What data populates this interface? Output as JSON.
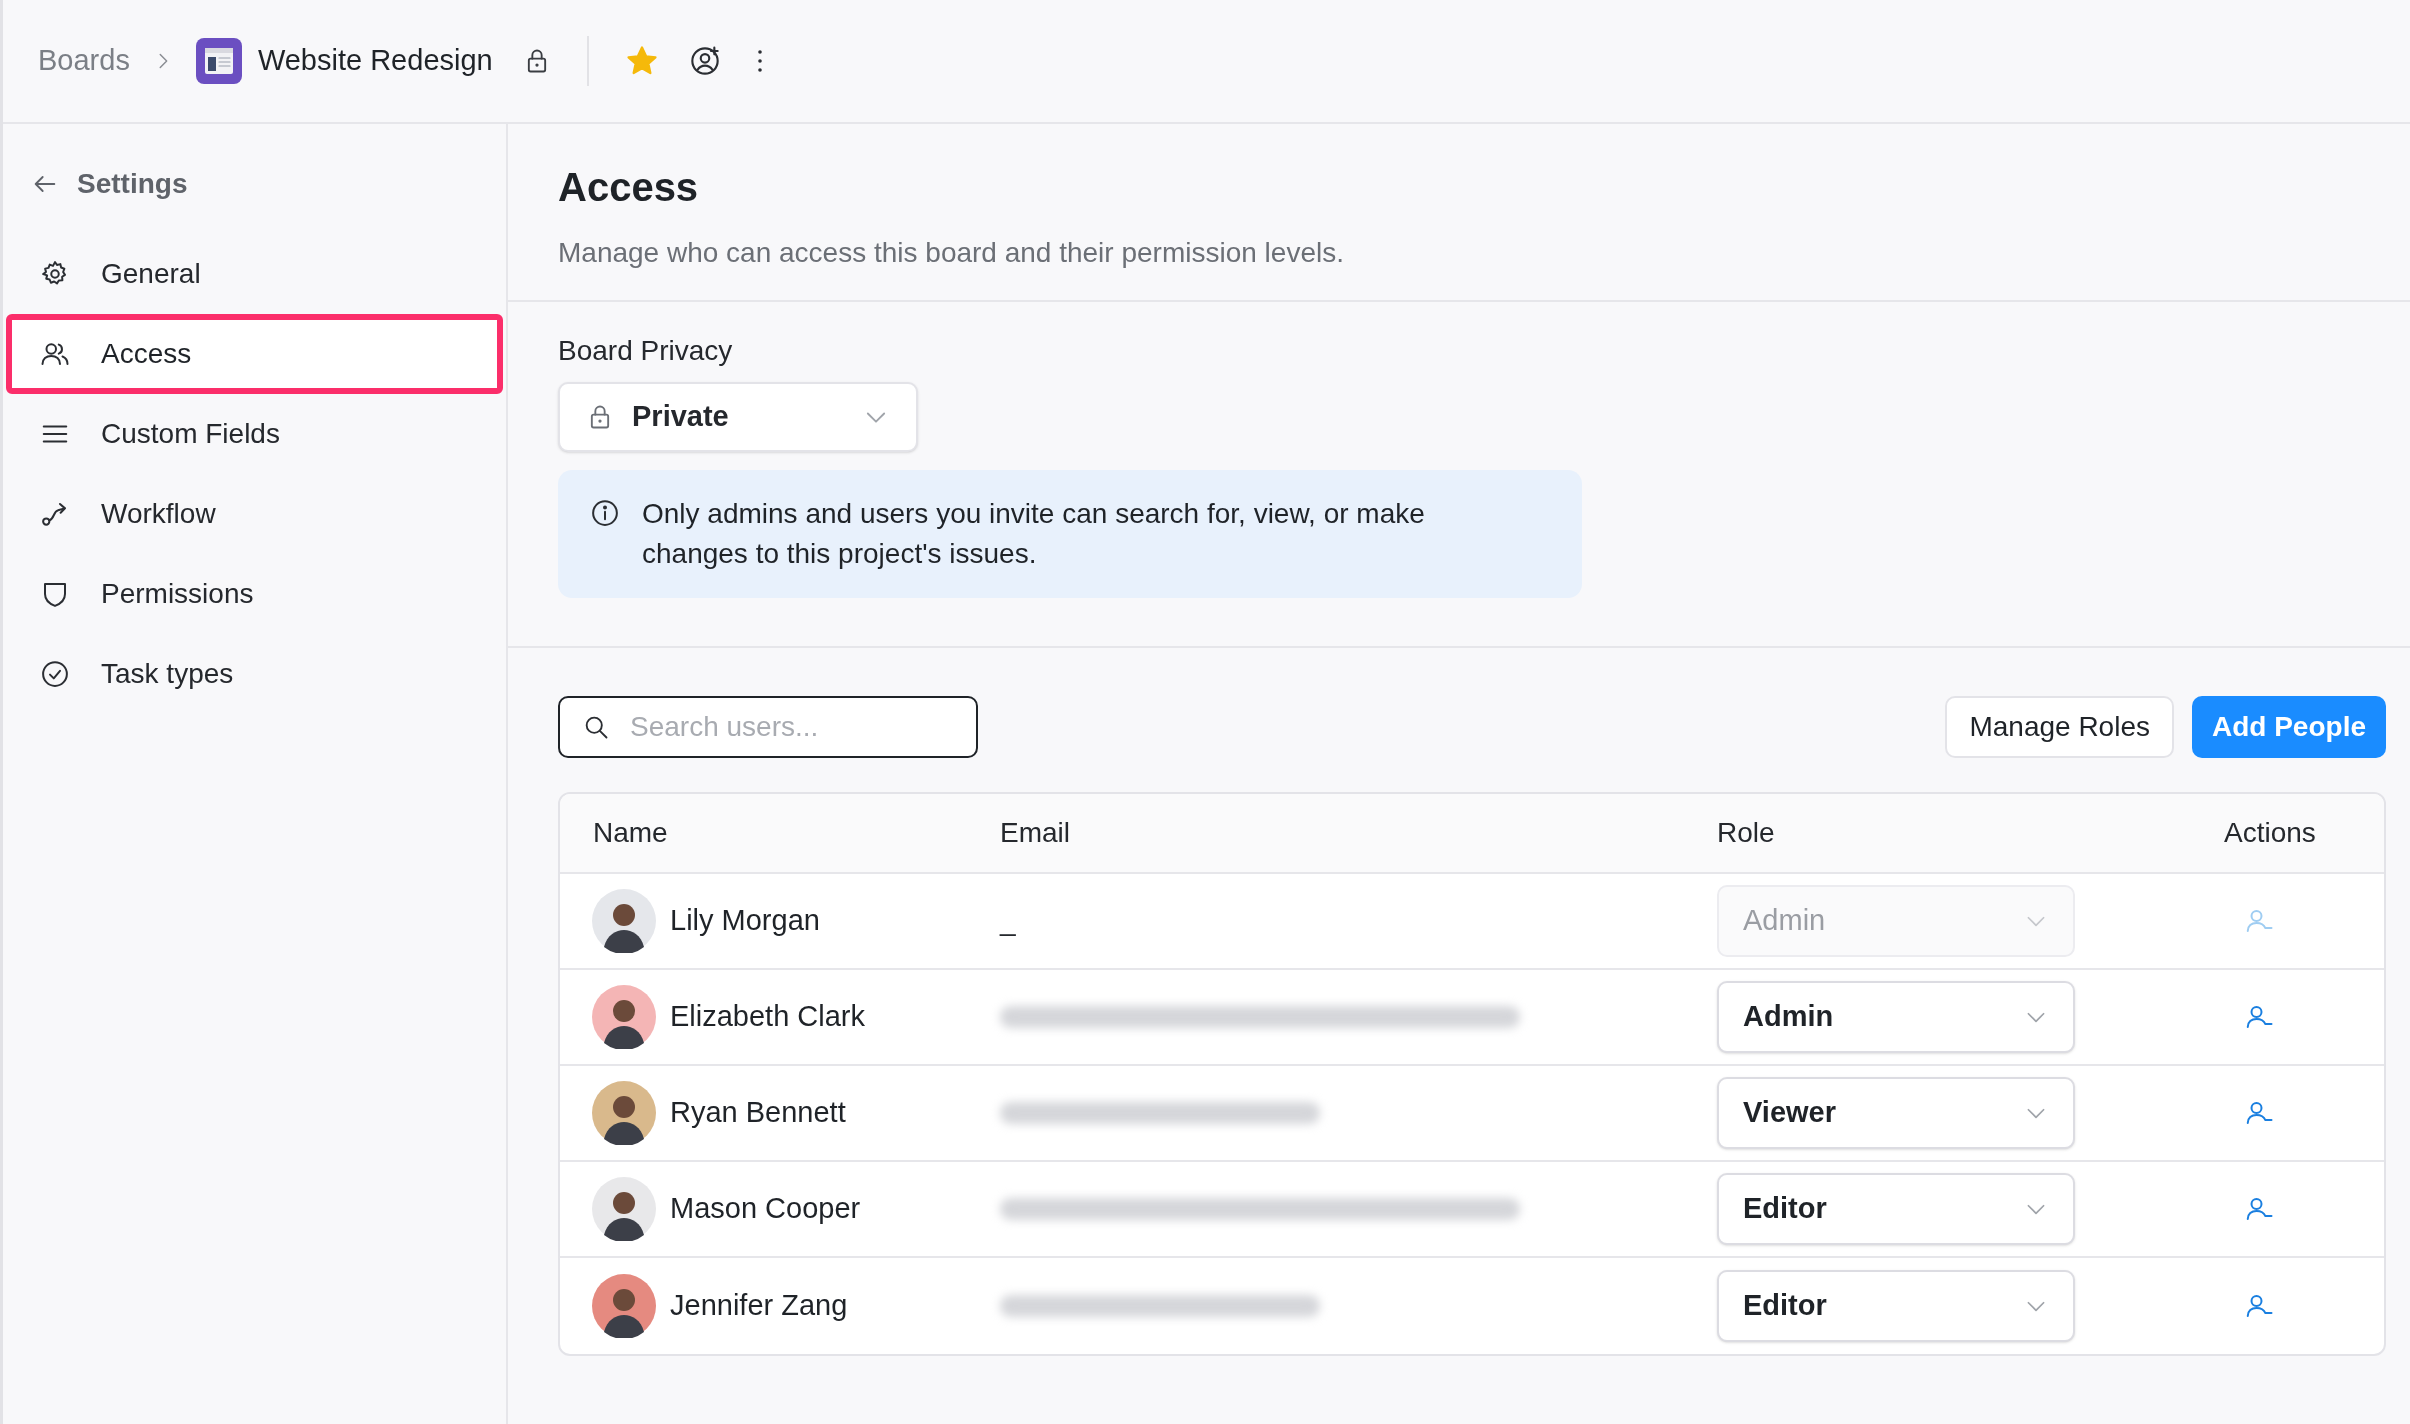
{
  "breadcrumb": {
    "root": "Boards",
    "board": "Website Redesign",
    "starred": true
  },
  "sidebar": {
    "back_label": "Settings",
    "items": [
      {
        "label": "General",
        "kind": "gear",
        "selected": false
      },
      {
        "label": "Access",
        "kind": "people",
        "selected": true
      },
      {
        "label": "Custom Fields",
        "kind": "lines",
        "selected": false
      },
      {
        "label": "Workflow",
        "kind": "flow",
        "selected": false
      },
      {
        "label": "Permissions",
        "kind": "shield",
        "selected": false
      },
      {
        "label": "Task types",
        "kind": "check",
        "selected": false
      }
    ]
  },
  "page": {
    "title": "Access",
    "description": "Manage who can access this board and their permission levels."
  },
  "privacy": {
    "label": "Board Privacy",
    "value": "Private",
    "info": "Only admins and users you invite can search for, view, or make changes to this project's issues."
  },
  "search": {
    "placeholder": "Search users..."
  },
  "buttons": {
    "secondary": "Manage Roles",
    "primary": "Add People"
  },
  "table": {
    "columns": [
      "Name",
      "Email",
      "Role",
      "Actions"
    ],
    "rows": [
      {
        "name": "Lily Morgan",
        "email": "_",
        "role": "Admin",
        "disabled": true,
        "color": "#e5e7eb"
      },
      {
        "name": "Elizabeth Clark",
        "email_blurred": true,
        "role": "Admin",
        "disabled": false,
        "color": "#f4b5b5"
      },
      {
        "name": "Ryan Bennett",
        "email_blurred": true,
        "role": "Viewer",
        "disabled": false,
        "color": "#d9b98c"
      },
      {
        "name": "Mason Cooper",
        "email_blurred": true,
        "role": "Editor",
        "disabled": false,
        "color": "#e8e8ea"
      },
      {
        "name": "Jennifer Zang",
        "email_blurred": true,
        "role": "Editor",
        "disabled": false,
        "color": "#e58a80"
      }
    ]
  }
}
